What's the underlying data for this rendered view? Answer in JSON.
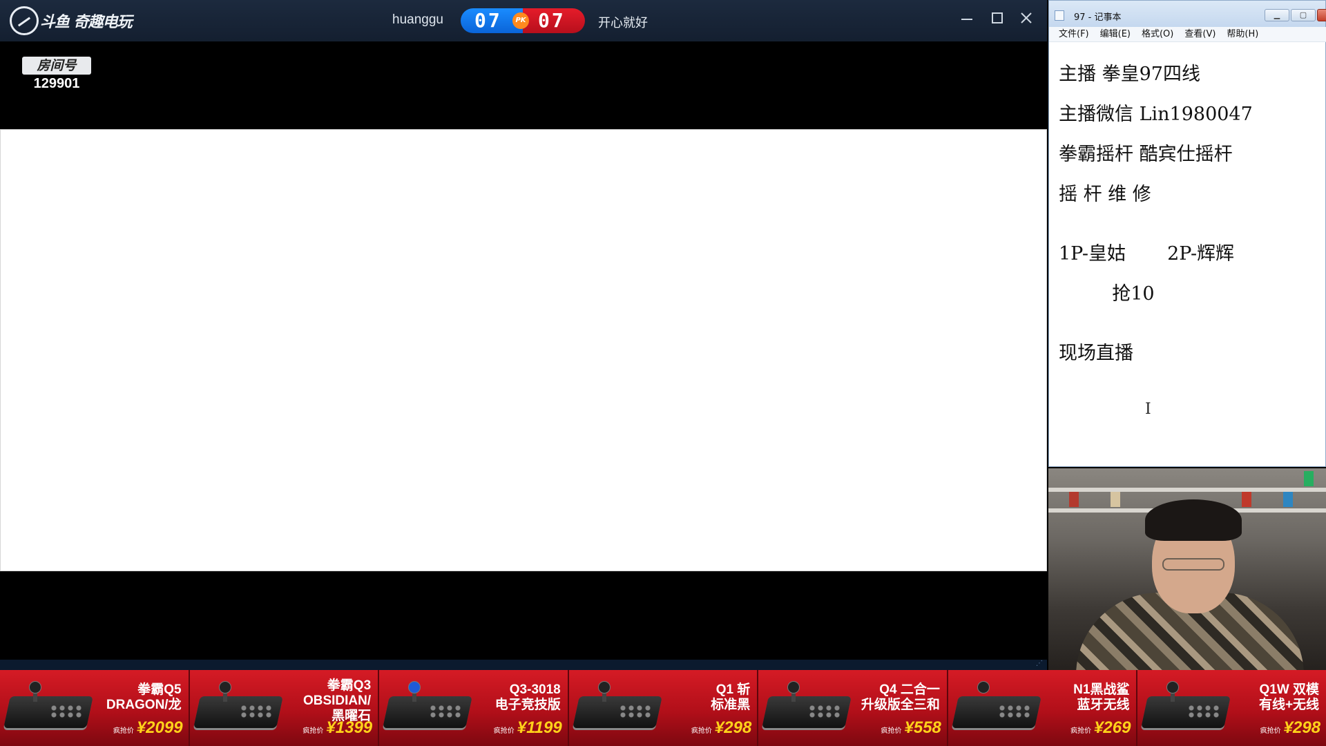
{
  "app": {
    "logo_text": "斗鱼 奇趣电玩",
    "player1_name": "huanggu",
    "score_left": "07",
    "pk_label": "PK",
    "score_right": "07",
    "player2_name": "开心就好",
    "room_label": "房间号",
    "room_number": "129901"
  },
  "notepad": {
    "title": "97 - 记事本",
    "menus": [
      "文件(F)",
      "编辑(E)",
      "格式(O)",
      "查看(V)",
      "帮助(H)"
    ],
    "lines": [
      "主播 拳皇97四线",
      "主播微信 Lin1980047",
      "拳霸摇杆 酷宾仕摇杆",
      "摇 杆 维 修",
      "",
      "1P-皇姑       2P-辉辉",
      "         抢10",
      "",
      "现场直播"
    ]
  },
  "ads": [
    {
      "name_line1": "拳霸Q5",
      "name_line2": "DRAGON/龙",
      "name_line3": "",
      "price_label": "疯抢价",
      "price": "¥2099"
    },
    {
      "name_line1": "拳霸Q3",
      "name_line2": "OBSIDIAN/",
      "name_line3": "黑曜石",
      "price_label": "疯抢价",
      "price": "¥1399"
    },
    {
      "name_line1": "Q3-3018",
      "name_line2": "电子竞技版",
      "name_line3": "",
      "price_label": "疯抢价",
      "price": "¥1199"
    },
    {
      "name_line1": "Q1 斩",
      "name_line2": "标准黑",
      "name_line3": "",
      "price_label": "疯抢价",
      "price": "¥298"
    },
    {
      "name_line1": "Q4 二合一",
      "name_line2": "升级版全三和",
      "name_line3": "",
      "price_label": "疯抢价",
      "price": "¥558"
    },
    {
      "name_line1": "N1黑战鲨",
      "name_line2": "蓝牙无线",
      "name_line3": "",
      "price_label": "疯抢价",
      "price": "¥269"
    },
    {
      "name_line1": "Q1W 双模",
      "name_line2": "有线+无线",
      "name_line3": "",
      "price_label": "疯抢价",
      "price": "¥298"
    }
  ],
  "icons": {
    "minimize": "minimize-icon",
    "maximize": "maximize-icon",
    "close": "close-icon",
    "text_cursor": "i-beam-cursor-icon"
  },
  "colors": {
    "score_blue": "#1a8cff",
    "score_red": "#e51c2a",
    "ad_red": "#d51b25",
    "price_yellow": "#ffd21a"
  }
}
